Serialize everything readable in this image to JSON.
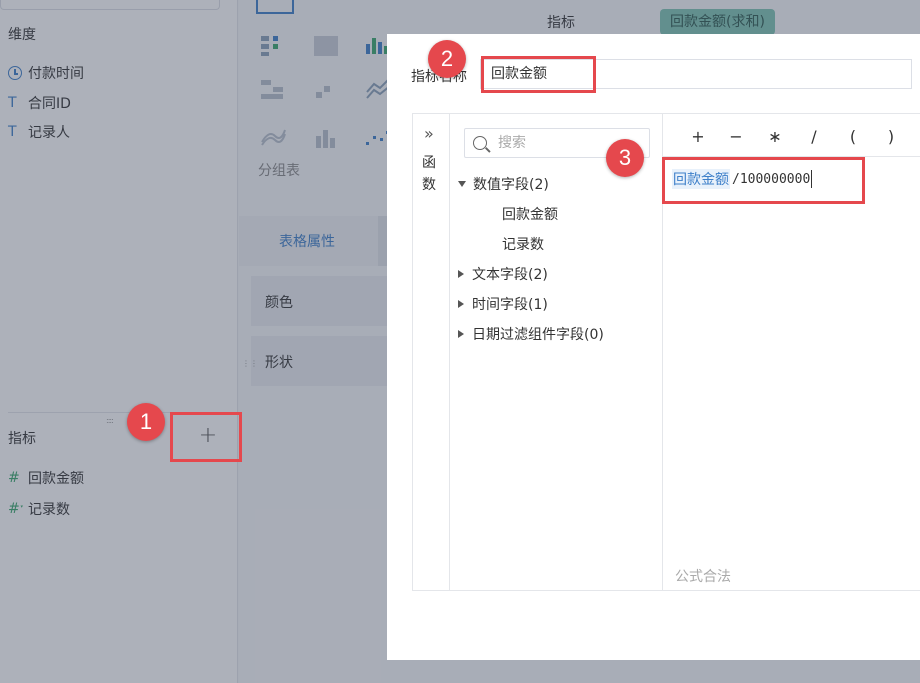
{
  "left_panel": {
    "dimension_title": "维度",
    "dimensions": [
      {
        "label": "付款时间",
        "icon": "clock-icon"
      },
      {
        "label": "合同ID",
        "icon": "text-type-icon",
        "glyph": "T"
      },
      {
        "label": "记录人",
        "icon": "text-type-icon",
        "glyph": "T"
      }
    ],
    "metric_title": "指标",
    "add_button": "+",
    "metrics": [
      {
        "label": "回款金额",
        "icon": "number-icon",
        "glyph": "#"
      },
      {
        "label": "记录数",
        "icon": "calculated-number-icon",
        "glyph": "#ˑ"
      }
    ]
  },
  "middle_panel": {
    "group_label": "分组表",
    "props_tab": "表格属性",
    "props": [
      "颜色",
      "形状"
    ]
  },
  "right_panel": {
    "metric_label": "指标",
    "metric_pill": "回款金额(求和)"
  },
  "dialog": {
    "name_label": "指标名称",
    "name_value": "回款金额",
    "func_chevron": "»",
    "func_label": "函数",
    "search_placeholder": "搜索",
    "tree": [
      {
        "label": "数值字段(2)",
        "expanded": true,
        "children": [
          "回款金额",
          "记录数"
        ]
      },
      {
        "label": "文本字段(2)",
        "expanded": false
      },
      {
        "label": "时间字段(1)",
        "expanded": false
      },
      {
        "label": "日期过滤组件字段(0)",
        "expanded": false
      }
    ],
    "operators": [
      "+",
      "−",
      "∗",
      "/",
      "(",
      ")"
    ],
    "formula_token": "回款金额",
    "formula_rest": "/100000000",
    "status": "公式合法"
  },
  "annotations": [
    "1",
    "2",
    "3"
  ],
  "colors": {
    "accent": "#3d7fc9",
    "annotation_red": "#e5484d",
    "pill": "#7fc4b4"
  }
}
